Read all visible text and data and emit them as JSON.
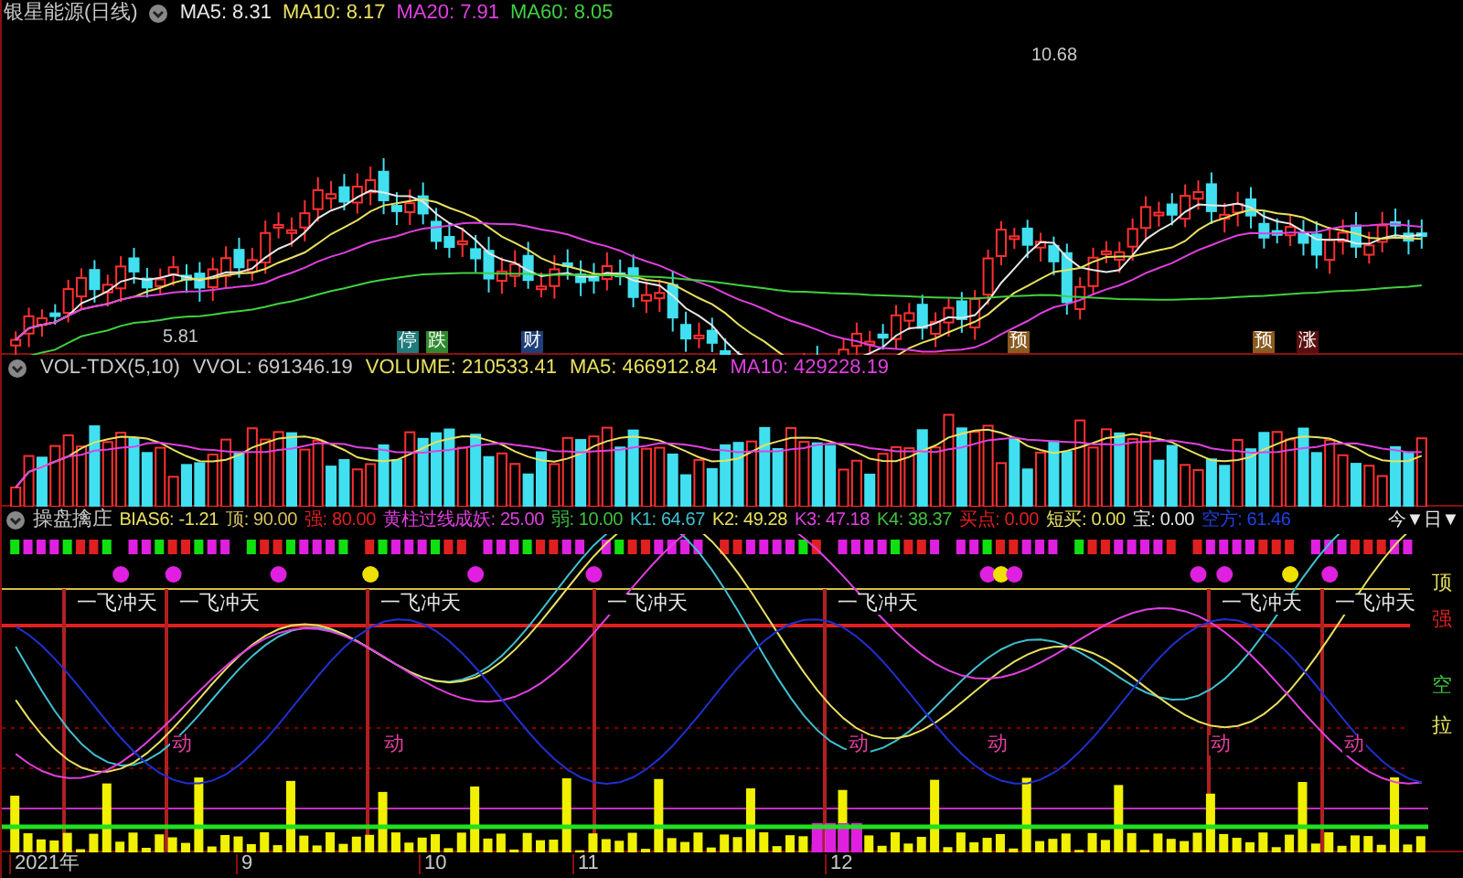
{
  "price_panel": {
    "title": "银星能源(日线)",
    "indicators": [
      {
        "label": "MA5: 8.31",
        "color": "#e8e8e8"
      },
      {
        "label": "MA10: 8.17",
        "color": "#e8e060"
      },
      {
        "label": "MA20: 7.91",
        "color": "#e040e0"
      },
      {
        "label": "MA60: 8.05",
        "color": "#40d040"
      }
    ],
    "price_labels": [
      "10.68",
      "5.81"
    ],
    "event_tags": [
      {
        "text": "停",
        "color": "#1f7a7a"
      },
      {
        "text": "跌",
        "color": "#2f8a2f"
      },
      {
        "text": "财",
        "color": "#1f3f7a"
      },
      {
        "text": "预",
        "color": "#8a5a1f"
      },
      {
        "text": "预",
        "color": "#8a5a1f"
      },
      {
        "text": "涨",
        "color": "#5a1010"
      }
    ]
  },
  "volume_panel": {
    "readings": [
      {
        "label": "VOL-TDX(5,10)",
        "color": "#c8c8c8"
      },
      {
        "label": "VVOL: 691346.19",
        "color": "#c8c8c8"
      },
      {
        "label": "VOLUME: 210533.41",
        "color": "#e8e060"
      },
      {
        "label": "MA5: 466912.84",
        "color": "#e8e060"
      },
      {
        "label": "MA10: 429228.19",
        "color": "#e040e0"
      }
    ]
  },
  "indicator_panel": {
    "title": "操盘擒庄",
    "readings": [
      {
        "label": "BIAS6: -1.21",
        "color": "#e8e060"
      },
      {
        "label": "顶: 90.00",
        "color": "#d8c060"
      },
      {
        "label": "强: 80.00",
        "color": "#e02020"
      },
      {
        "label": "黄柱过线成妖: 25.00",
        "color": "#e040e0"
      },
      {
        "label": "弱: 10.00",
        "color": "#40c040"
      },
      {
        "label": "K1: 64.67",
        "color": "#40c0d0"
      },
      {
        "label": "K2: 49.28",
        "color": "#e8e060"
      },
      {
        "label": "K3: 47.18",
        "color": "#e040e0"
      },
      {
        "label": "K4: 38.37",
        "color": "#40c040"
      },
      {
        "label": "买点: 0.00",
        "color": "#e02020"
      },
      {
        "label": "短买: 0.00",
        "color": "#e8e060"
      },
      {
        "label": "宝: 0.00",
        "color": "#e8e8e8"
      },
      {
        "label": "空方: 61.46",
        "color": "#2040e0"
      }
    ],
    "menu": "今▼日▼",
    "pattern_labels": [
      "一飞冲天",
      "一飞冲天",
      "一飞冲天",
      "一飞冲天",
      "一飞冲天",
      "一飞冲天",
      "一飞冲天"
    ],
    "signal_labels": [
      "动",
      "动",
      "动",
      "动",
      "动",
      "动"
    ],
    "right_labels": [
      {
        "text": "顶",
        "color": "#e8e060"
      },
      {
        "text": "强",
        "color": "#e02020"
      },
      {
        "text": "空",
        "color": "#40c040"
      },
      {
        "text": "拉",
        "color": "#e8e060"
      }
    ]
  },
  "time_axis": [
    "2021年",
    "9",
    "10",
    "11",
    "12"
  ]
}
